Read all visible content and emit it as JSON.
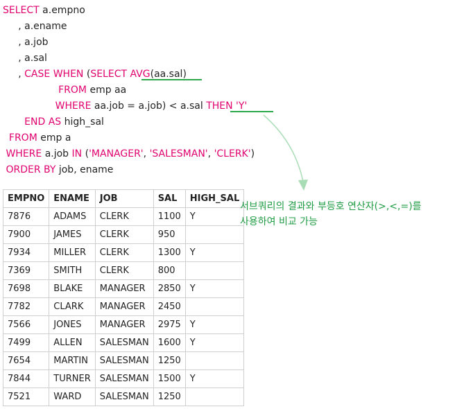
{
  "sql": {
    "line1": {
      "kw": "SELECT",
      "rest": " a.empno"
    },
    "line2": {
      "rest": "     , a.ename"
    },
    "line3": {
      "rest": "     , a.job"
    },
    "line4": {
      "rest": "     , a.sal"
    },
    "line5": {
      "prefix": "     , ",
      "kw_case": "CASE",
      "kw_when": "WHEN",
      "lparen": " (",
      "kw_select": "SELECT",
      "kw_avg": "AVG",
      "avg_rest": "(aa.sal)"
    },
    "line6": {
      "indent": "                  ",
      "kw_from": "FROM",
      "rest": " emp aa"
    },
    "line7": {
      "indent": "                 ",
      "kw_where": "WHERE",
      "rest": " aa.job = a.job) < a.sal ",
      "kw_then": "THEN",
      "str_y": " 'Y'"
    },
    "line8": {
      "indent": "       ",
      "kw_end": "END",
      "kw_as": "AS",
      "rest": " high_sal"
    },
    "line9": {
      "indent": "  ",
      "kw_from": "FROM",
      "rest": " emp a"
    },
    "line10": {
      "indent": " ",
      "kw_where": "WHERE",
      "pre": " a.job ",
      "kw_in": "IN",
      "lparen": " (",
      "s1": "'MANAGER'",
      "comma1": ", ",
      "s2": "'SALESMAN'",
      "comma2": ", ",
      "s3": "'CLERK'",
      "rparen": ")"
    },
    "line11": {
      "indent": " ",
      "kw_order": "ORDER",
      "kw_by": "BY",
      "rest": " job, ename"
    }
  },
  "table": {
    "headers": [
      "EMPNO",
      "ENAME",
      "JOB",
      "SAL",
      "HIGH_SAL"
    ],
    "rows": [
      [
        "7876",
        "ADAMS",
        "CLERK",
        "1100",
        "Y"
      ],
      [
        "7900",
        "JAMES",
        "CLERK",
        "950",
        ""
      ],
      [
        "7934",
        "MILLER",
        "CLERK",
        "1300",
        "Y"
      ],
      [
        "7369",
        "SMITH",
        "CLERK",
        "800",
        ""
      ],
      [
        "7698",
        "BLAKE",
        "MANAGER",
        "2850",
        "Y"
      ],
      [
        "7782",
        "CLARK",
        "MANAGER",
        "2450",
        ""
      ],
      [
        "7566",
        "JONES",
        "MANAGER",
        "2975",
        "Y"
      ],
      [
        "7499",
        "ALLEN",
        "SALESMAN",
        "1600",
        "Y"
      ],
      [
        "7654",
        "MARTIN",
        "SALESMAN",
        "1250",
        ""
      ],
      [
        "7844",
        "TURNER",
        "SALESMAN",
        "1500",
        "Y"
      ],
      [
        "7521",
        "WARD",
        "SALESMAN",
        "1250",
        ""
      ]
    ]
  },
  "annotation": {
    "line1": "서브쿼리의 결과와 부등호 연산자(>,<,=)를",
    "line2": "사용하여 비교 가능"
  },
  "colors": {
    "keyword": "#e0006e",
    "text": "#222222",
    "accent_green": "#2aa84a",
    "annotation_green": "#1f9c43",
    "table_border": "#cfcfcf"
  }
}
